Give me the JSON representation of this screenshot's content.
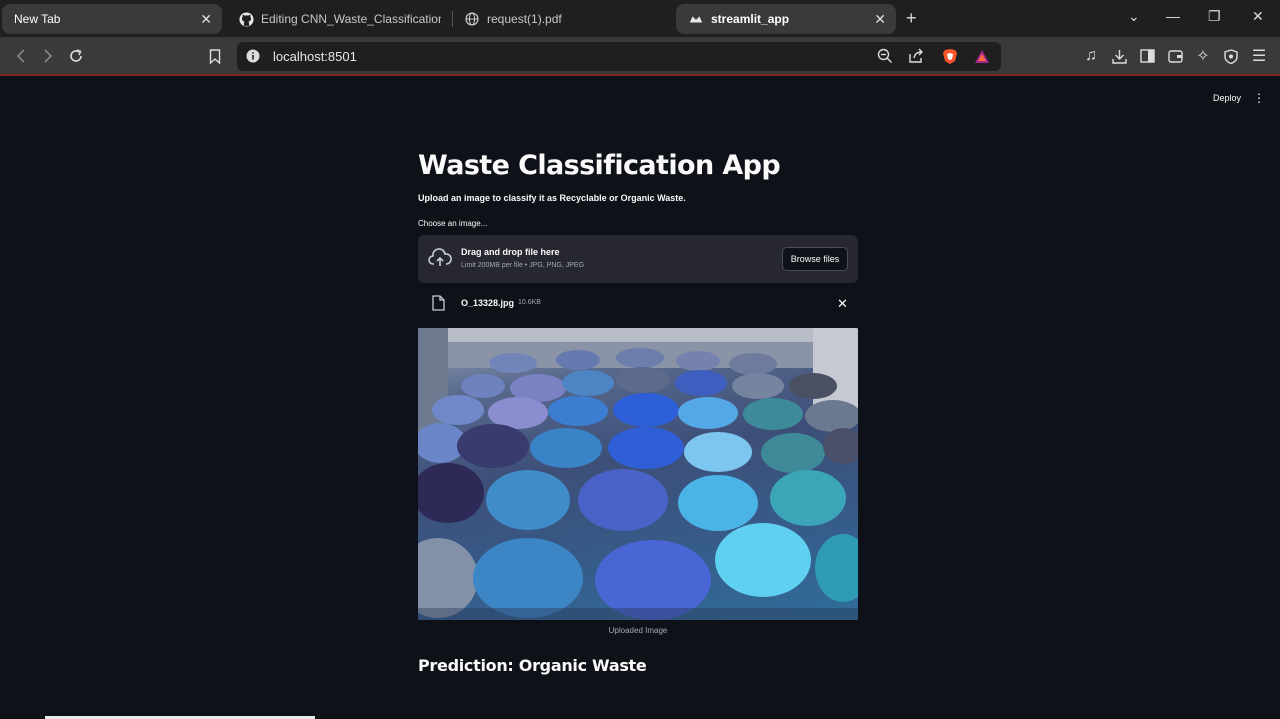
{
  "browser": {
    "tabs": [
      {
        "label": "New Tab",
        "active": true
      },
      {
        "label": "Editing CNN_Waste_Classification/R",
        "icon": "github-icon"
      },
      {
        "label": "request(1).pdf",
        "icon": "globe-icon"
      },
      {
        "label": "streamlit_app",
        "active": true,
        "icon": "streamlit-icon"
      }
    ],
    "url": "localhost:8501"
  },
  "app": {
    "deploy_label": "Deploy",
    "title": "Waste Classification App",
    "subtitle": "Upload an image to classify it as Recyclable or Organic Waste.",
    "uploader": {
      "label": "Choose an image...",
      "drag_text": "Drag and drop file here",
      "limit_text": "Limit 200MB per file • JPG, PNG, JPEG",
      "browse_label": "Browse files"
    },
    "file": {
      "name": "O_13328.jpg",
      "size": "10.6KB"
    },
    "image_caption": "Uploaded Image",
    "prediction": "Prediction: Organic Waste"
  },
  "colors": {
    "background": "#0e1117",
    "panel": "#262730",
    "text": "#fafafa"
  }
}
